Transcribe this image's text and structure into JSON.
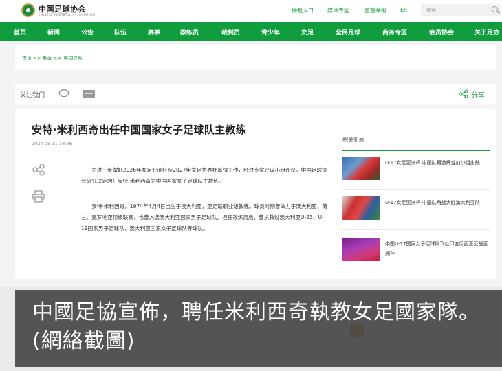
{
  "header": {
    "logo_text": "中国足球协会",
    "logo_subtext": "CHINESE FOOTBALL ASSOCIATION",
    "top_links": [
      "仲裁入口",
      "媒体专区",
      "监督举报",
      "En"
    ],
    "search_placeholder": "搜索"
  },
  "nav": {
    "items": [
      "首页",
      "新闻",
      "公告",
      "队伍",
      "赛事",
      "教练员",
      "裁判员",
      "青少年",
      "女足",
      "全民足球",
      "商务专区",
      "会员协会",
      "关于足协"
    ]
  },
  "breadcrumb": {
    "text": "首页 >> 新闻 >> 中国之队"
  },
  "share_bar": {
    "follow_label": "关注我们",
    "share_label": "分享"
  },
  "article": {
    "title": "安特·米利西奇出任中国国家女子足球队主教练",
    "date": "2024-05-11 18:06",
    "paragraphs": [
      "为进一步做好2026年女足亚洲杯及2027年女足世界杯备战工作，经过专家评议小组评议，中国足球协会研究决定聘任安特·米利西奇为中国国家女子足球队主教练。",
      "安特·米利西奇，1974年4月4日出生于澳大利亚，亚足联职业级教练。球员时期曾效力于澳大利亚、荷兰、克罗地亚顶级联赛，也曾入选澳大利亚国家男子足球队。担任教练员后，曾执教过澳大利亚U-23、U-19国家男子足球队、澳大利亚国家女子足球队等球队。"
    ]
  },
  "related": {
    "title": "相关新闻",
    "items": [
      {
        "text": "U-17女足亚洲杯 中国队再造辉煌前小组出线"
      },
      {
        "text": "U-17女足亚洲杯 中国队角战大胜澳大利亚队"
      },
      {
        "text": "中国U-17国家女子足球队飞赴印度尼西亚征战亚洲杯"
      }
    ]
  },
  "caption": {
    "text": "中國足協宣佈，聘任米利西奇執教女足國家隊。(網絡截圖)"
  },
  "colors": {
    "brand_green": "#0f9d3d",
    "link_green": "#1a9c3d"
  }
}
